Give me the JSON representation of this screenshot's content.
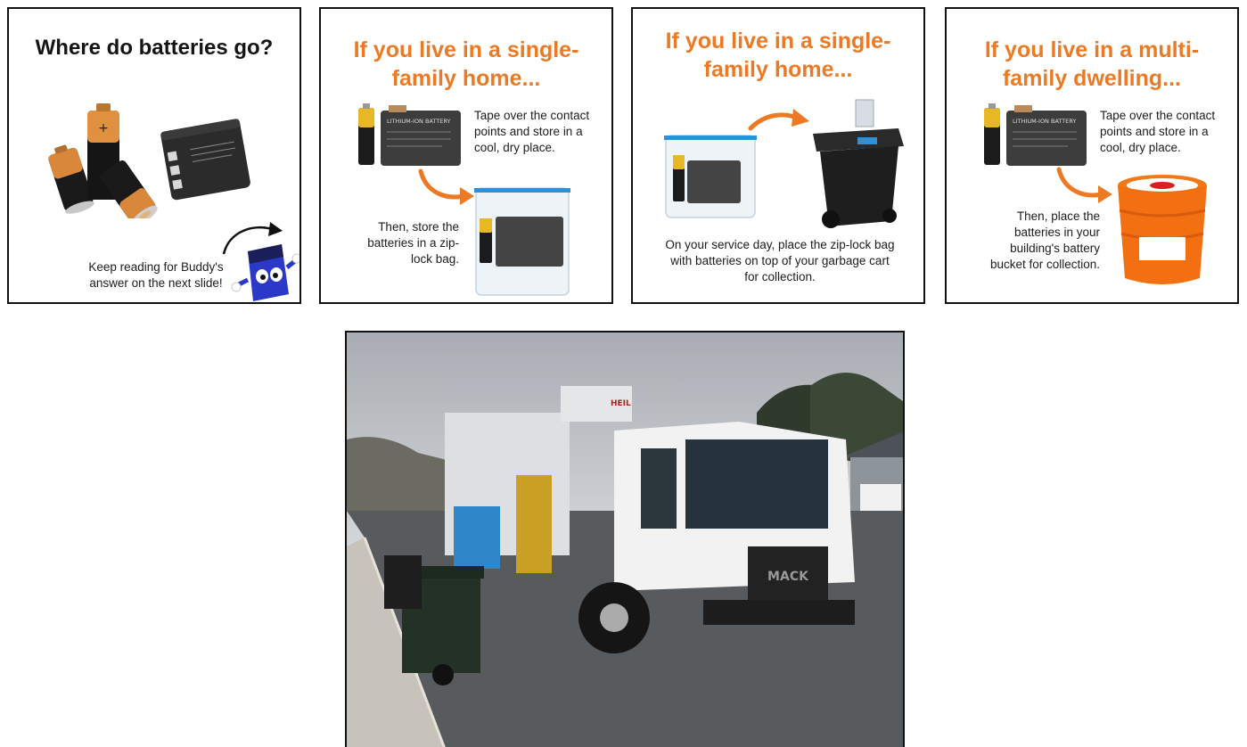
{
  "slides": [
    {
      "title": "Where do batteries go?",
      "caption": "Keep reading for Buddy's answer on the next slide!",
      "caption_line1": "Keep reading for Buddy's",
      "caption_line2": "answer on the next slide!"
    },
    {
      "title_line1": "If you live in a single-",
      "title_line2": "family home...",
      "step1_line1": "Tape over the contact",
      "step1_line2": "points and store in a",
      "step1_line3": "cool, dry place.",
      "step2_line1": "Then, store the",
      "step2_line2": "batteries in a zip-",
      "step2_line3": "lock bag."
    },
    {
      "title_line1": "If you live in a single-",
      "title_line2": "family home...",
      "step_line1": "On your service day, place the zip-lock bag",
      "step_line2": "with batteries on top of your garbage cart",
      "step_line3": "for collection."
    },
    {
      "title_line1": "If you live in a multi-",
      "title_line2": "family dwelling...",
      "step1_line1": "Tape over the contact",
      "step1_line2": "points and store in a",
      "step1_line3": "cool, dry place.",
      "step2_line1": "Then, place the",
      "step2_line2": "batteries in your",
      "step2_line3": "building's battery",
      "step2_line4": "bucket for collection."
    }
  ],
  "battery_label": "LITHIUM-ION BATTERY",
  "truck_brand": "MACK",
  "body_brand": "HEIL",
  "colors": {
    "accent_orange": "#ec7a24",
    "border": "#111111",
    "bag_blue": "#2f8fd8"
  },
  "icons": [
    "aa-battery-icon",
    "lithium-battery-icon",
    "zip-bag-icon",
    "garbage-cart-icon",
    "battery-bucket-icon",
    "arrow-icon",
    "buddy-mascot-icon"
  ]
}
